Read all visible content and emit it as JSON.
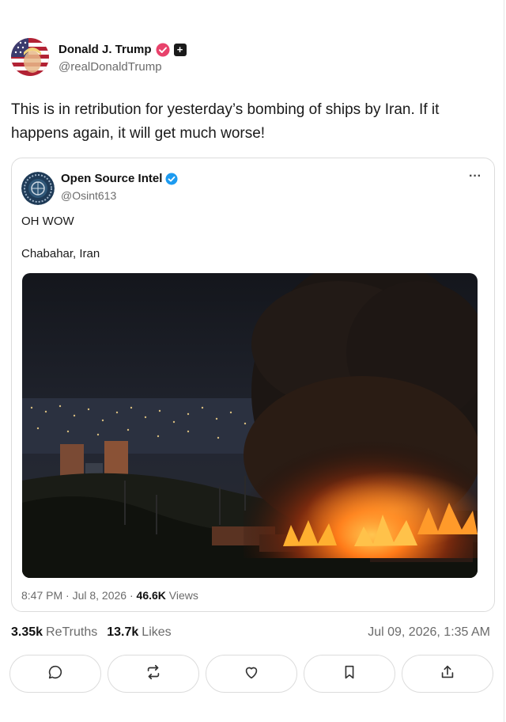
{
  "post": {
    "author": {
      "display_name": "Donald J. Trump",
      "handle": "@realDonaldTrump",
      "plus_badge": "+"
    },
    "text": "This is in retribution for yesterday’s bombing of ships by Iran. If it happens again, it will get much worse!",
    "stats": {
      "retruths_count": "3.35k",
      "retruths_label": "ReTruths",
      "likes_count": "13.7k",
      "likes_label": "Likes"
    },
    "timestamp": "Jul 09, 2026, 1:35 AM"
  },
  "quoted_post": {
    "author": {
      "display_name": "Open Source Intel",
      "handle": "@Osint613"
    },
    "more_label": "···",
    "text_line1": "OH WOW",
    "text_line2": "Chabahar, Iran",
    "time": "8:47 PM · Jul 8, 2026 · ",
    "views_count": "46.6K",
    "views_label": " Views"
  },
  "actions": [
    {
      "name": "reply",
      "icon": "comment-icon"
    },
    {
      "name": "retruth",
      "icon": "retruth-icon"
    },
    {
      "name": "like",
      "icon": "heart-icon"
    },
    {
      "name": "bookmark",
      "icon": "bookmark-icon"
    },
    {
      "name": "share",
      "icon": "share-icon"
    }
  ],
  "colors": {
    "verified_badge": "#e8426b",
    "quote_verified_badge": "#1d9bf0",
    "muted_text": "#6b6b6b",
    "border": "#dcdcdc"
  }
}
